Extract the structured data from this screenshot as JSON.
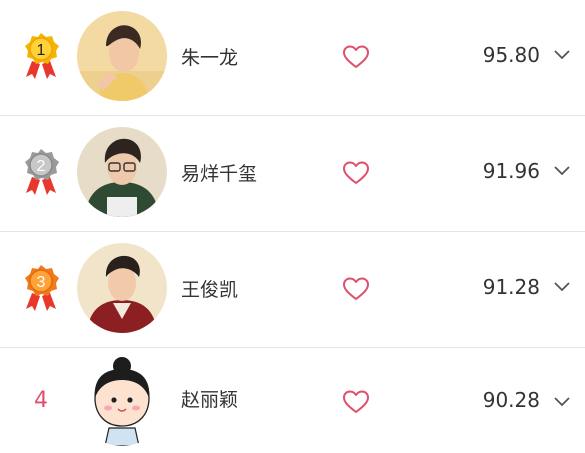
{
  "ranking": {
    "rows": [
      {
        "rank": "1",
        "badge_color": "#f5b400",
        "name": "朱一龙",
        "score": "95.80",
        "avatar_icon": "person-photo-icon",
        "heart_icon": "heart-outline-icon",
        "expand_icon": "chevron-down-icon"
      },
      {
        "rank": "2",
        "badge_color": "#9a9a9a",
        "name": "易烊千玺",
        "score": "91.96",
        "avatar_icon": "person-photo-icon",
        "heart_icon": "heart-outline-icon",
        "expand_icon": "chevron-down-icon"
      },
      {
        "rank": "3",
        "badge_color": "#f07a1a",
        "name": "王俊凯",
        "score": "91.28",
        "avatar_icon": "person-photo-icon",
        "heart_icon": "heart-outline-icon",
        "expand_icon": "chevron-down-icon"
      },
      {
        "rank": "4",
        "badge_color": "#e0506d",
        "name": "赵丽颖",
        "score": "90.28",
        "avatar_icon": "cartoon-girl-icon",
        "heart_icon": "heart-outline-icon",
        "expand_icon": "chevron-down-icon"
      }
    ]
  },
  "colors": {
    "accent_pink": "#e0506d",
    "text": "#333333",
    "divider": "#e6e6e6",
    "ribbon_red": "#e8372c"
  }
}
